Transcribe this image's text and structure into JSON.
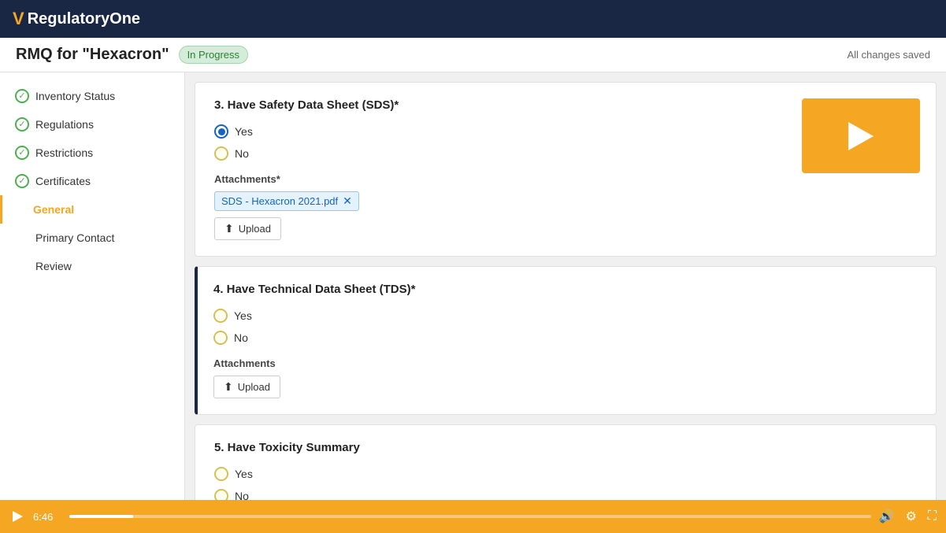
{
  "app": {
    "logo_symbol": "V",
    "logo_name": "RegulatoryOne"
  },
  "header": {
    "title": "RMQ for \"Hexacron\"",
    "status": "In Progress",
    "auto_save": "All changes saved"
  },
  "sidebar": {
    "items": [
      {
        "id": "inventory-status",
        "label": "Inventory Status",
        "checked": true,
        "active": false
      },
      {
        "id": "regulations",
        "label": "Regulations",
        "checked": true,
        "active": false
      },
      {
        "id": "restrictions",
        "label": "Restrictions",
        "checked": true,
        "active": false
      },
      {
        "id": "certificates",
        "label": "Certificates",
        "checked": true,
        "active": false
      },
      {
        "id": "general",
        "label": "General",
        "checked": false,
        "active": true
      },
      {
        "id": "primary-contact",
        "label": "Primary Contact",
        "checked": false,
        "active": false
      },
      {
        "id": "review",
        "label": "Review",
        "checked": false,
        "active": false
      }
    ]
  },
  "questions": {
    "q3": {
      "title": "3. Have Safety Data Sheet (SDS)*",
      "yes_label": "Yes",
      "no_label": "No",
      "yes_selected": true,
      "no_selected": false,
      "attachments_label": "Attachments*",
      "attachment_file": "SDS - Hexacron 2021.pdf",
      "upload_label": "Upload"
    },
    "q4": {
      "title": "4. Have Technical Data Sheet (TDS)*",
      "yes_label": "Yes",
      "no_label": "No",
      "yes_selected": false,
      "no_selected": false,
      "attachments_label": "Attachments",
      "upload_label": "Upload"
    },
    "q5": {
      "title": "5. Have Toxicity Summary",
      "yes_label": "Yes",
      "no_label": "No"
    }
  },
  "player": {
    "time": "6:46",
    "play_label": "▶"
  }
}
